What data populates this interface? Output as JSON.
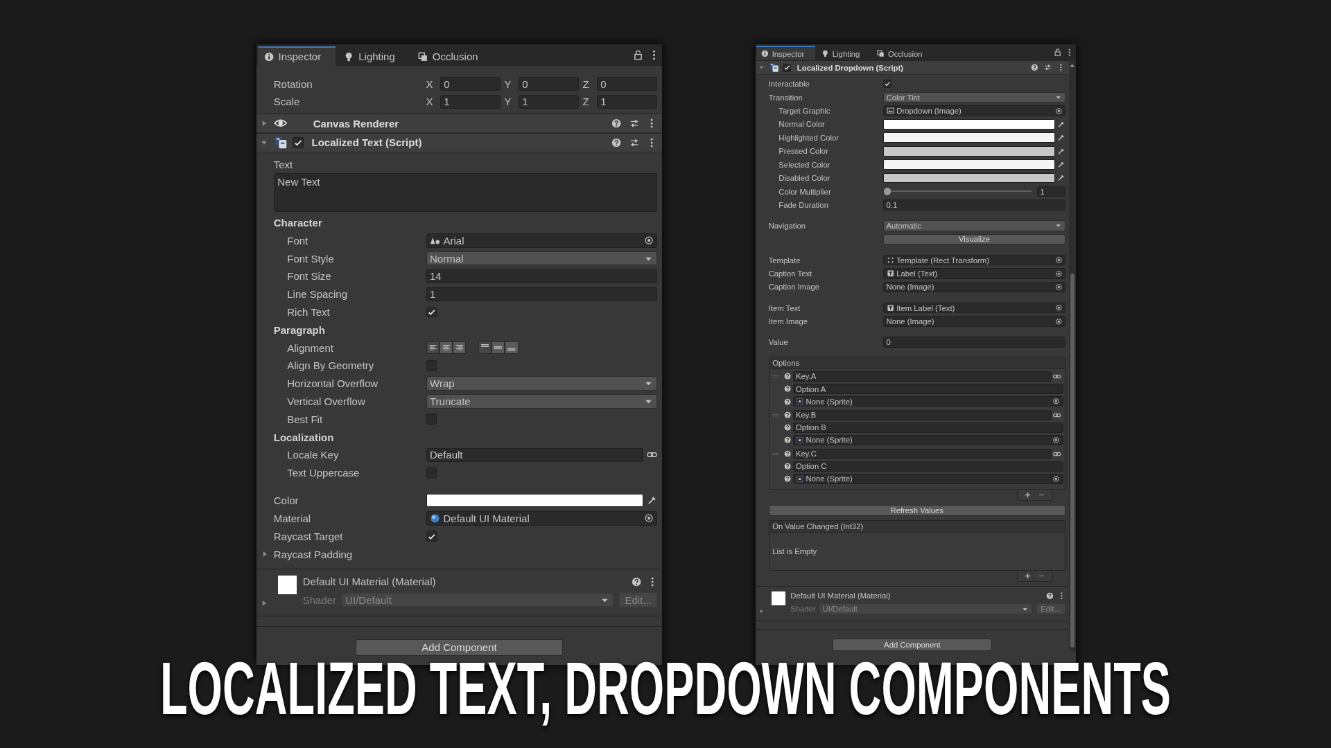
{
  "panels": [
    {
      "tabs": [
        {
          "label": "Inspector",
          "selected": true
        },
        {
          "label": "Lighting",
          "selected": false
        },
        {
          "label": "Occlusion",
          "selected": false
        }
      ],
      "blocks": [
        {
          "kind": "fields",
          "rows": [
            {
              "kind": "vector3",
              "label": "Rotation",
              "fields": [
                {
                  "axis": "X",
                  "value": "0"
                },
                {
                  "axis": "Y",
                  "value": "0"
                },
                {
                  "axis": "Z",
                  "value": "0"
                }
              ]
            },
            {
              "kind": "vector3",
              "label": "Scale",
              "fields": [
                {
                  "axis": "X",
                  "value": "1"
                },
                {
                  "axis": "Y",
                  "value": "1"
                },
                {
                  "axis": "Z",
                  "value": "1"
                }
              ]
            }
          ]
        },
        {
          "kind": "component",
          "title": "Canvas Renderer",
          "expanded": false
        },
        {
          "kind": "component",
          "title": "Localized Text (Script)",
          "expanded": true,
          "enabled": true,
          "groups": [
            {
              "rows": [
                {
                  "kind": "label",
                  "label": "Text"
                },
                {
                  "kind": "textarea",
                  "value": "New Text"
                },
                {
                  "kind": "section",
                  "label": "Character",
                  "children": [
                    {
                      "kind": "object",
                      "label": "Font",
                      "value": "Arial"
                    },
                    {
                      "kind": "dropdown",
                      "label": "Font Style",
                      "value": "Normal"
                    },
                    {
                      "kind": "input",
                      "label": "Font Size",
                      "value": "14"
                    },
                    {
                      "kind": "input",
                      "label": "Line Spacing",
                      "value": "1"
                    },
                    {
                      "kind": "checkbox",
                      "label": "Rich Text",
                      "checked": true
                    }
                  ]
                },
                {
                  "kind": "section",
                  "label": "Paragraph",
                  "children": [
                    {
                      "kind": "alignment",
                      "label": "Alignment",
                      "buttons": [
                        {
                          "selected": true
                        },
                        {
                          "selected": false
                        },
                        {
                          "selected": false
                        },
                        {
                          "selected": true
                        },
                        {
                          "selected": false
                        },
                        {
                          "selected": false
                        }
                      ]
                    },
                    {
                      "kind": "checkbox",
                      "label": "Align By Geometry",
                      "checked": false
                    },
                    {
                      "kind": "dropdown",
                      "label": "Horizontal Overflow",
                      "value": "Wrap"
                    },
                    {
                      "kind": "dropdown",
                      "label": "Vertical Overflow",
                      "value": "Truncate"
                    },
                    {
                      "kind": "checkbox",
                      "label": "Best Fit",
                      "checked": false
                    }
                  ]
                },
                {
                  "kind": "section",
                  "label": "Localization",
                  "children": [
                    {
                      "kind": "link",
                      "label": "Locale Key",
                      "value": "Default"
                    },
                    {
                      "kind": "checkbox",
                      "label": "Text Uppercase",
                      "checked": false
                    }
                  ]
                }
              ]
            },
            {
              "rows": [
                {
                  "kind": "color",
                  "label": "Color",
                  "color": "#ffffff"
                },
                {
                  "kind": "object",
                  "label": "Material",
                  "value": "Default UI Material"
                },
                {
                  "kind": "checkbox",
                  "label": "Raycast Target",
                  "checked": true
                },
                {
                  "kind": "foldout",
                  "label": "Raycast Padding",
                  "expanded": false
                }
              ]
            }
          ]
        },
        {
          "kind": "material",
          "title": "Default UI Material (Material)",
          "shader_label": "Shader",
          "shader": "UI/Default",
          "edit": "Edit..."
        },
        {
          "kind": "add",
          "label": "Add Component"
        }
      ]
    },
    {
      "tabs": [
        {
          "label": "Inspector",
          "selected": true
        },
        {
          "label": "Lighting",
          "selected": false
        },
        {
          "label": "Occlusion",
          "selected": false
        }
      ],
      "blocks": [
        {
          "kind": "component",
          "title": "Localized Dropdown (Script)",
          "expanded": true,
          "enabled": true,
          "groups": [
            {
              "rows": [
                {
                  "kind": "checkbox",
                  "label": "Interactable",
                  "checked": true
                },
                {
                  "kind": "dropdown",
                  "label": "Transition",
                  "value": "Color Tint",
                  "children": [
                    {
                      "kind": "object",
                      "label": "Target Graphic",
                      "value": "Dropdown (Image)"
                    },
                    {
                      "kind": "color",
                      "label": "Normal Color",
                      "color": "#ffffff"
                    },
                    {
                      "kind": "color",
                      "label": "Highlighted Color",
                      "color": "#f5f5f5"
                    },
                    {
                      "kind": "color",
                      "label": "Pressed Color",
                      "color": "#c8c8c8"
                    },
                    {
                      "kind": "color",
                      "label": "Selected Color",
                      "color": "#f5f5f5"
                    },
                    {
                      "kind": "color",
                      "label": "Disabled Color",
                      "color": "#c8c8c8"
                    },
                    {
                      "kind": "slider",
                      "label": "Color Multiplier",
                      "level": 0,
                      "value": "1"
                    },
                    {
                      "kind": "input",
                      "label": "Fade Duration",
                      "value": "0.1"
                    }
                  ]
                }
              ]
            },
            {
              "rows": [
                {
                  "kind": "dropdown",
                  "label": "Navigation",
                  "value": "Automatic"
                },
                {
                  "kind": "button",
                  "label": "Visualize"
                }
              ]
            },
            {
              "rows": [
                {
                  "kind": "object",
                  "label": "Template",
                  "value": "Template (Rect Transform)"
                },
                {
                  "kind": "object",
                  "label": "Caption Text",
                  "value": "Label (Text)"
                },
                {
                  "kind": "object",
                  "label": "Caption Image",
                  "value": "None (Image)"
                }
              ]
            },
            {
              "rows": [
                {
                  "kind": "object",
                  "label": "Item Text",
                  "value": "Item Label (Text)"
                },
                {
                  "kind": "object",
                  "label": "Item Image",
                  "value": "None (Image)"
                }
              ]
            },
            {
              "rows": [
                {
                  "kind": "input",
                  "label": "Value",
                  "value": "0"
                }
              ]
            },
            {
              "rows": [
                {
                  "kind": "options",
                  "title": "Options",
                  "items": [
                    {
                      "key": "Key.A",
                      "text": "Option A",
                      "sprite": "None (Sprite)"
                    },
                    {
                      "key": "Key.B",
                      "text": "Option B",
                      "sprite": "None (Sprite)"
                    },
                    {
                      "key": "Key.C",
                      "text": "Option C",
                      "sprite": "None (Sprite)"
                    }
                  ]
                },
                {
                  "kind": "wide-button",
                  "label": "Refresh Values"
                },
                {
                  "kind": "event",
                  "title": "On Value Changed (Int32)",
                  "empty": "List is Empty"
                }
              ]
            }
          ]
        },
        {
          "kind": "material",
          "title": "Default UI Material (Material)",
          "shader_label": "Shader",
          "shader": "UI/Default",
          "edit": "Edit..."
        },
        {
          "kind": "add",
          "label": "Add Component"
        }
      ]
    }
  ],
  "caption": "LOCALIZED TEXT, DROPDOWN COMPONENTS"
}
